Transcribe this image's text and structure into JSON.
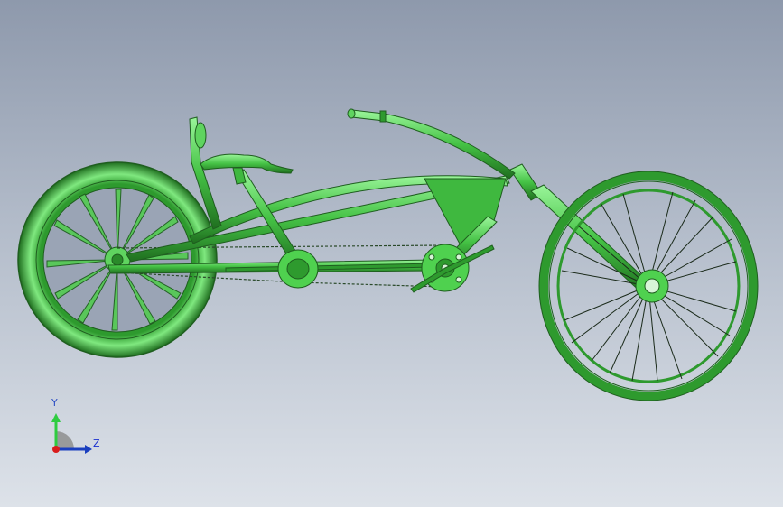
{
  "viewport": {
    "background_top": "#8e99ac",
    "background_bottom": "#dde2e9",
    "model_color": "#4fd14f",
    "edge_color": "#1f5e1f"
  },
  "triad": {
    "y_label": "Y",
    "z_label": "Z",
    "y_color": "#2ecc40",
    "z_color": "#1a3fbf",
    "origin_color": "#d91c1c"
  }
}
